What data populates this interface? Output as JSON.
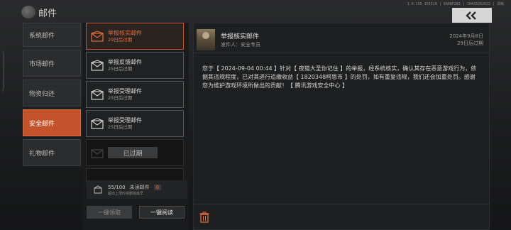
{
  "header": {
    "title": "邮件",
    "build_text": "1.0.155.155310 | 0908F283 | 10433282822 | 清晰"
  },
  "categories": [
    {
      "label": "系统邮件",
      "active": false
    },
    {
      "label": "市场邮件",
      "active": false
    },
    {
      "label": "物资归还",
      "active": false
    },
    {
      "label": "安全邮件",
      "active": true
    },
    {
      "label": "礼物邮件",
      "active": false
    }
  ],
  "mails": [
    {
      "title": "举报核实邮件",
      "sub": "29日后过期",
      "state": "selected"
    },
    {
      "title": "举报反馈邮件",
      "sub": "25日后过期",
      "state": "normal"
    },
    {
      "title": "举报受理邮件",
      "sub": "25日后过期",
      "state": "normal"
    },
    {
      "title": "举报受理邮件",
      "sub": "25日后过期",
      "state": "normal"
    },
    {
      "title": "",
      "sub": "",
      "state": "expired",
      "tag": "已过期"
    }
  ],
  "count_bar": {
    "count": "55/100",
    "unread_label": "未读邮件",
    "unread_count": "0",
    "note": "超出上限时将删除最早"
  },
  "buttons": {
    "claim": "一键领取",
    "read": "一键阅读"
  },
  "detail": {
    "title": "举报核实邮件",
    "sender": "发件人：安全专员",
    "date": "2024年9月8日",
    "expire": "29日后过期",
    "body": "您于【 2024-09-04 00:44 】针对【 夜猫大圣你记住 】的举报，经系统核实，确认其存在恶意游戏行为，依据其违规程度，已对其进行追缴收益【 1820348柯恩币 】的处罚，如有重复违规，我们还会加重处罚。感谢您为维护游戏环境所做出的贡献！【 腾讯游戏安全中心 】"
  },
  "colors": {
    "accent": "#c4532b",
    "accent_text": "#e36d3d"
  },
  "icons": [
    "planet-logo-icon",
    "back-arrow-icon",
    "envelope-icon",
    "mailbox-icon",
    "trash-icon"
  ]
}
